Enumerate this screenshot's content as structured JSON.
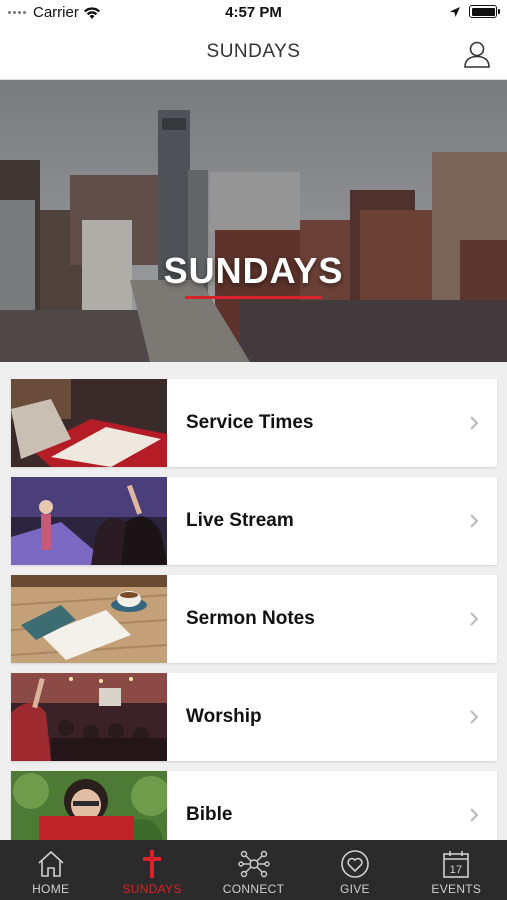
{
  "status_bar": {
    "carrier": "Carrier",
    "time": "4:57 PM",
    "battery_percent": 100
  },
  "nav": {
    "title": "SUNDAYS"
  },
  "hero": {
    "title": "SUNDAYS",
    "accent_color": "#d8232a"
  },
  "menu_items": [
    {
      "label": "Service Times",
      "image": "open-bible-photo"
    },
    {
      "label": "Live Stream",
      "image": "concert-stage-photo"
    },
    {
      "label": "Sermon Notes",
      "image": "notebook-coffee-photo"
    },
    {
      "label": "Worship",
      "image": "worship-crowd-photo"
    },
    {
      "label": "Bible",
      "image": "reading-bible-photo"
    }
  ],
  "tabs": [
    {
      "label": "HOME",
      "icon": "home-icon",
      "active": false
    },
    {
      "label": "SUNDAYS",
      "icon": "cross-icon",
      "active": true
    },
    {
      "label": "CONNECT",
      "icon": "network-icon",
      "active": false
    },
    {
      "label": "GIVE",
      "icon": "heart-icon",
      "active": false
    },
    {
      "label": "EVENTS",
      "icon": "calendar-icon",
      "active": false
    }
  ],
  "calendar_day": "17",
  "colors": {
    "tab_bar_bg": "#2b2b2b",
    "active_tab": "#d8232a",
    "inactive_tab": "#cfcfcf"
  }
}
